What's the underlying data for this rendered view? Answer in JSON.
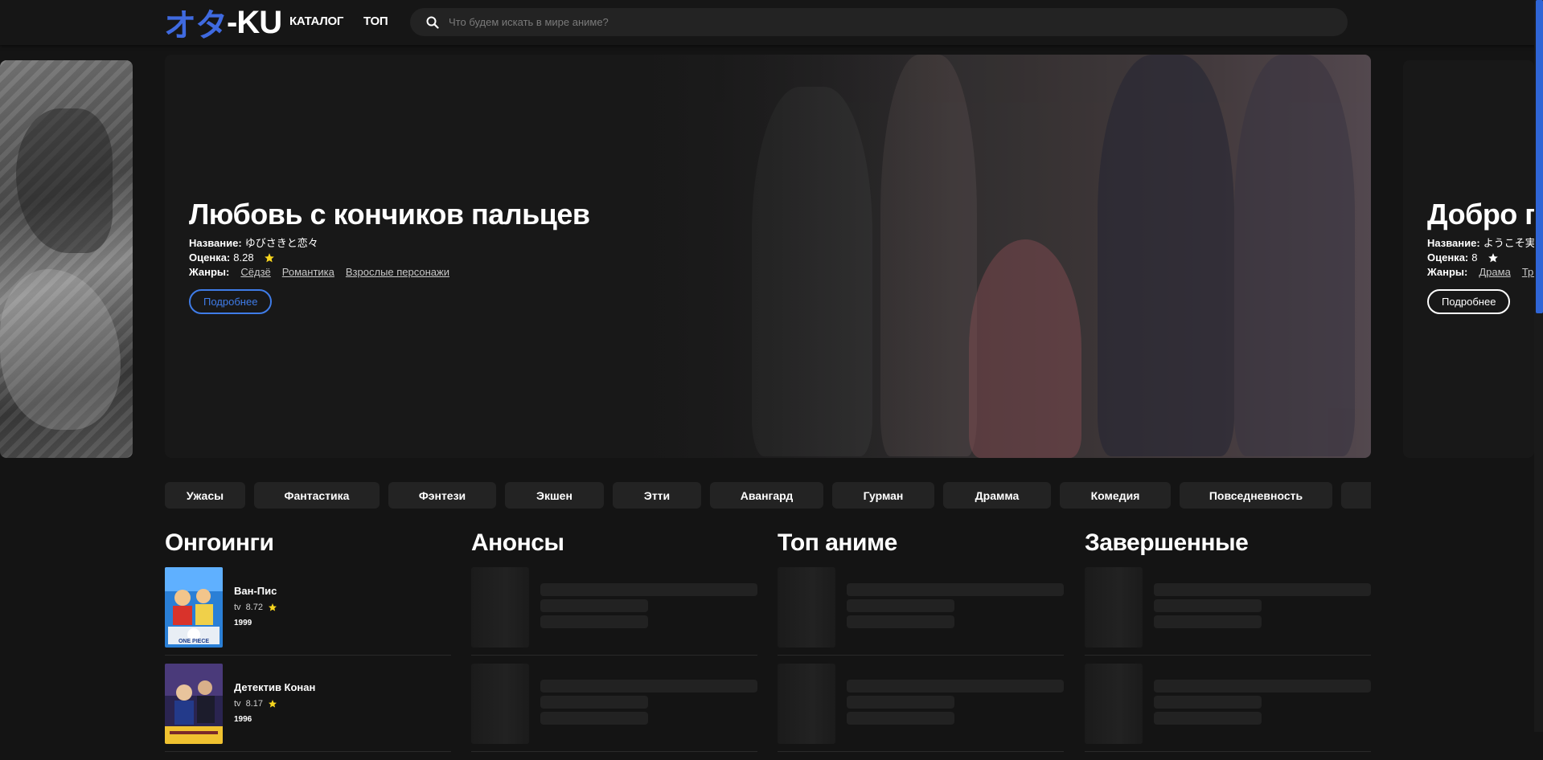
{
  "header": {
    "logo_accent": "オタ",
    "logo_rest": "-KU",
    "nav": {
      "catalog": "КАТАЛОГ",
      "top": "ТОП"
    },
    "search_placeholder": "Что будем искать в мире аниме?"
  },
  "hero": {
    "title": "Любовь с кончиков пальцев",
    "name_label": "Название:",
    "name_value": "ゆびさきと恋々",
    "rating_label": "Оценка:",
    "rating_value": "8.28",
    "genres_label": "Жанры:",
    "genres": [
      "Сёдзё",
      "Романтика",
      "Взрослые персонажи"
    ],
    "more_label": "Подробнее"
  },
  "hero_next": {
    "title": "Добро по",
    "name_label": "Название:",
    "name_value": "ようこそ実",
    "rating_label": "Оценка:",
    "rating_value": "8",
    "genres_label": "Жанры:",
    "genres": [
      "Драма",
      "Три"
    ],
    "more_label": "Подробнее"
  },
  "genre_chips": [
    "Ужасы",
    "Фантастика",
    "Фэнтези",
    "Экшен",
    "Этти",
    "Авангард",
    "Гурман",
    "Драмма",
    "Комедия",
    "Повседневность",
    ""
  ],
  "columns": {
    "ongoing": {
      "title": "Онгоинги",
      "items": [
        {
          "name": "Ван-Пис",
          "kind": "tv",
          "score": "8.72",
          "year": "1999"
        },
        {
          "name": "Детектив Конан",
          "kind": "tv",
          "score": "8.17",
          "year": "1996"
        }
      ]
    },
    "announced": {
      "title": "Анонсы"
    },
    "top": {
      "title": "Топ аниме"
    },
    "finished": {
      "title": "Завершенные"
    }
  },
  "colors": {
    "background": "#141414",
    "accent_blue": "#3f6ae0",
    "button_blue": "#3f7ce8",
    "star_yellow": "#f7d51e",
    "chip_bg": "#232323"
  },
  "icons": {
    "search": "search-icon",
    "star": "star-icon"
  }
}
